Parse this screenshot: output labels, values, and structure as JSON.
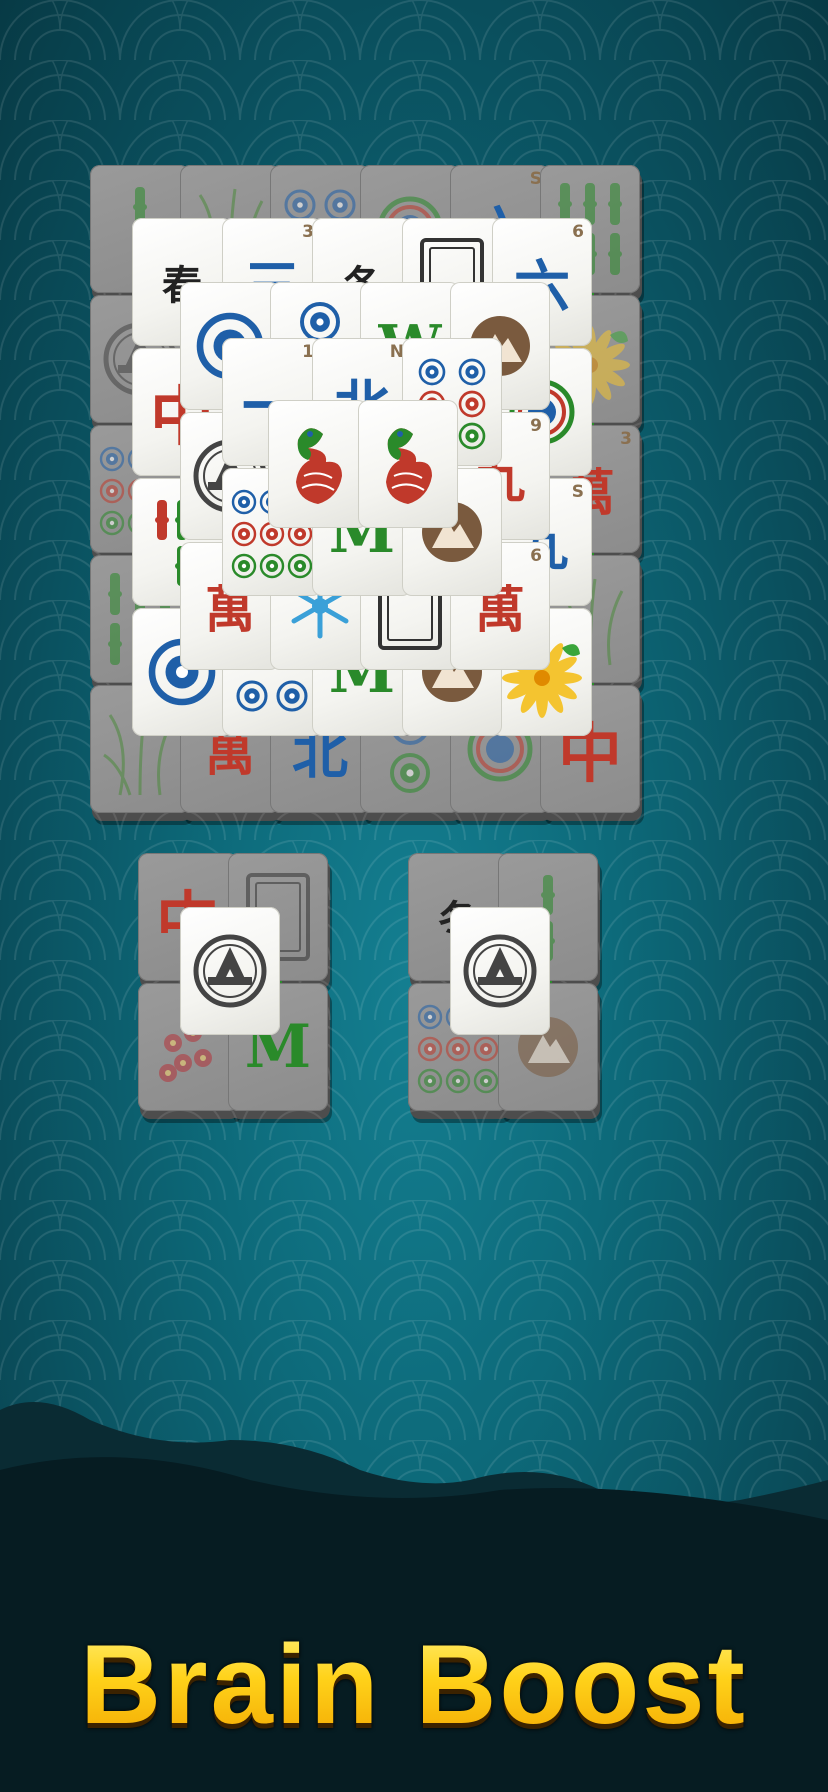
{
  "title": "Brain Boost",
  "colors": {
    "accent_gold": "#ffd21f",
    "tile_edge": "#2a8f2a",
    "background": "#0d6a7a"
  },
  "tiles": {
    "spring": "春",
    "winter": "冬",
    "three": "三",
    "six": "六",
    "one": "一",
    "north": "北",
    "red_dragon": "中",
    "wan": "萬",
    "nine": "九",
    "green_dragon": "M",
    "green_w": "W",
    "corner_3": "3",
    "corner_6": "6",
    "corner_1": "1",
    "corner_n": "N",
    "corner_9": "9",
    "corner_s": "S"
  }
}
